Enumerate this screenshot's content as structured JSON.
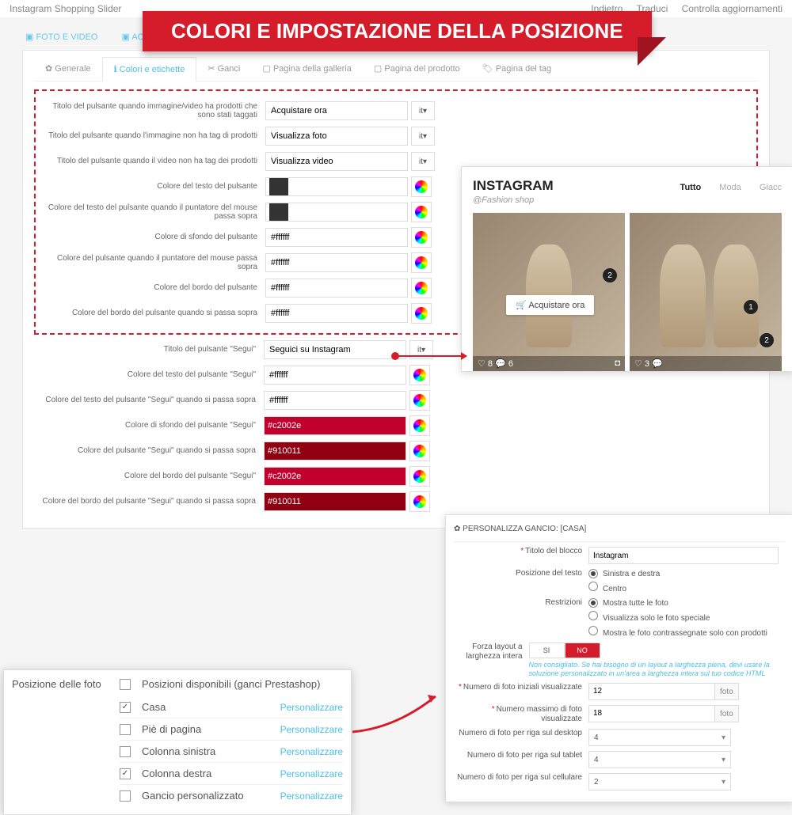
{
  "top": {
    "title": "Instagram Shopping Slider",
    "back": "Indietro",
    "translate": "Traduci",
    "updates": "Controlla aggiornamenti"
  },
  "banner": "COLORI E IMPOSTAZIONE DELLA POSIZIONE",
  "toolbar": {
    "t1": "FOTO E VIDEO",
    "t2": "ACCO"
  },
  "tabs": [
    "Generale",
    "Colori e etichette",
    "Ganci",
    "Pagina della galleria",
    "Pagina del prodotto",
    "Pagina del tag"
  ],
  "fields": {
    "f1": {
      "l": "Titolo del pulsante quando immagine/video ha prodotti che sono stati taggati",
      "v": "Acquistare ora"
    },
    "f2": {
      "l": "Titolo del pulsante quando l'immagine non ha tag di prodotti",
      "v": "Visualizza foto"
    },
    "f3": {
      "l": "Titolo del pulsante quando il video non ha tag dei prodotti",
      "v": "Visualizza video"
    },
    "f4": {
      "l": "Colore del testo del pulsante",
      "v": "#333333",
      "c": "#333333"
    },
    "f5": {
      "l": "Colore del testo del pulsante quando il puntatore del mouse passa sopra",
      "v": "#333333",
      "c": "#333333"
    },
    "f6": {
      "l": "Colore di sfondo del pulsante",
      "v": "#ffffff",
      "c": "#ffffff"
    },
    "f7": {
      "l": "Colore del pulsante quando il puntatore del mouse passa sopra",
      "v": "#ffffff",
      "c": "#ffffff"
    },
    "f8": {
      "l": "Colore del bordo del pulsante",
      "v": "#ffffff",
      "c": "#ffffff"
    },
    "f9": {
      "l": "Colore del bordo del pulsante quando si passa sopra",
      "v": "#ffffff",
      "c": "#ffffff"
    },
    "f10": {
      "l": "Titolo del pulsante \"Segui\"",
      "v": "Seguici su Instagram"
    },
    "f11": {
      "l": "Colore del testo del pulsante \"Segui\"",
      "v": "#ffffff",
      "c": "#ffffff"
    },
    "f12": {
      "l": "Colore del testo del pulsante \"Segui\" quando si passa sopra",
      "v": "#ffffff",
      "c": "#ffffff"
    },
    "f13": {
      "l": "Colore di sfondo del pulsante \"Segui\"",
      "v": "#c2002e",
      "c": "#c2002e"
    },
    "f14": {
      "l": "Colore del pulsante \"Segui\" quando si passa sopra",
      "v": "#910011",
      "c": "#910011"
    },
    "f15": {
      "l": "Colore del bordo del pulsante \"Segui\"",
      "v": "#c2002e",
      "c": "#c2002e"
    },
    "f16": {
      "l": "Colore del bordo del pulsante \"Segui\" quando si passa sopra",
      "v": "#910011",
      "c": "#910011"
    }
  },
  "lang": "it▾",
  "preview": {
    "title": "INSTAGRAM",
    "sub": "@Fashion shop",
    "tutto": "Tutto",
    "moda": "Moda",
    "giacc": "Giacc",
    "buy": "Acquistare ora",
    "likes": "♡ 8  💬 6",
    "likes2": "♡ 3  💬"
  },
  "pos": {
    "title": "Posizione delle foto",
    "hdr": "Posizioni disponibili (ganci Prestashop)",
    "items": [
      {
        "l": "Casa",
        "ck": true
      },
      {
        "l": "Piè di pagina",
        "ck": false
      },
      {
        "l": "Colonna sinistra",
        "ck": false
      },
      {
        "l": "Colonna destra",
        "ck": true
      },
      {
        "l": "Gancio personalizzato",
        "ck": false
      }
    ],
    "pers": "Personalizzare"
  },
  "cust": {
    "hdr": "✿ PERSONALIZZA GANCIO: [CASA]",
    "r1": {
      "l": "Titolo del blocco",
      "v": "Instagram"
    },
    "r2": {
      "l": "Posizione del testo",
      "o1": "Sinistra e destra",
      "o2": "Centro"
    },
    "r3": {
      "l": "Restrizioni",
      "o1": "Mostra tutte le foto",
      "o2": "Visualizza solo le foto speciale",
      "o3": "Mostra le foto contrassegnate solo con prodotti"
    },
    "r4": {
      "l": "Forza layout a larghezza intera",
      "si": "SI",
      "no": "NO",
      "hint": "Non consigliato. Se hai bisogno di un layout a larghezza piena, devi usare la soluzione personalizzato in un'area a larghezza intera sul tuo codice HTML"
    },
    "r5": {
      "l": "Numero di foto iniziali visualizzate",
      "v": "12",
      "s": "foto"
    },
    "r6": {
      "l": "Numero massimo di foto visualizzate",
      "v": "18",
      "s": "foto"
    },
    "r7": {
      "l": "Numero di foto per riga sul desktop",
      "v": "4"
    },
    "r8": {
      "l": "Numero di foto per riga sul tablet",
      "v": "4"
    },
    "r9": {
      "l": "Numero di foto per riga sul cellulare",
      "v": "2"
    }
  }
}
